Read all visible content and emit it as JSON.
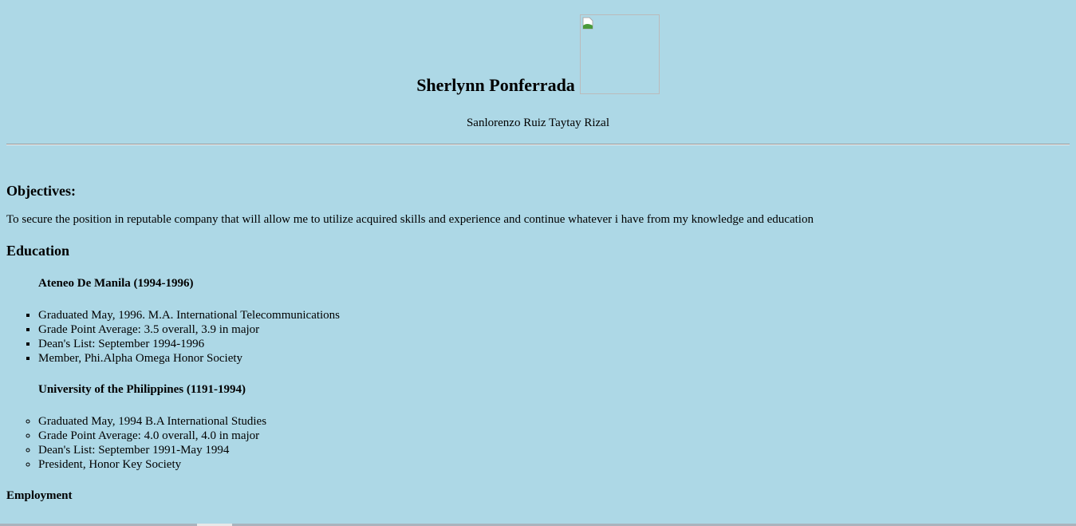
{
  "header": {
    "name": "Sherlynn Ponferrada",
    "photo_icon": "broken-image-icon",
    "address": "Sanlorenzo Ruiz Taytay Rizal"
  },
  "objectives": {
    "heading": "Objectives:",
    "text": "To secure the position in reputable company that will allow me to utilize acquired skills and experience and continue whatever i have from my knowledge and education"
  },
  "education": {
    "heading": "Education",
    "schools": [
      {
        "name": "Ateneo De Manila (1994-1996)",
        "items": [
          "Graduated May, 1996. M.A. International Telecommunications",
          "Grade Point Average: 3.5 overall, 3.9 in major",
          "Dean's List: September 1994-1996",
          "Member, Phi.Alpha Omega Honor Society"
        ]
      },
      {
        "name": "University of the Philippines (1191-1994)",
        "items": [
          "Graduated May, 1994 B.A International Studies",
          "Grade Point Average: 4.0 overall, 4.0 in major",
          "Dean's List: September 1991-May 1994",
          "President, Honor Key Society"
        ]
      }
    ]
  },
  "employment": {
    "heading": "Employment"
  }
}
